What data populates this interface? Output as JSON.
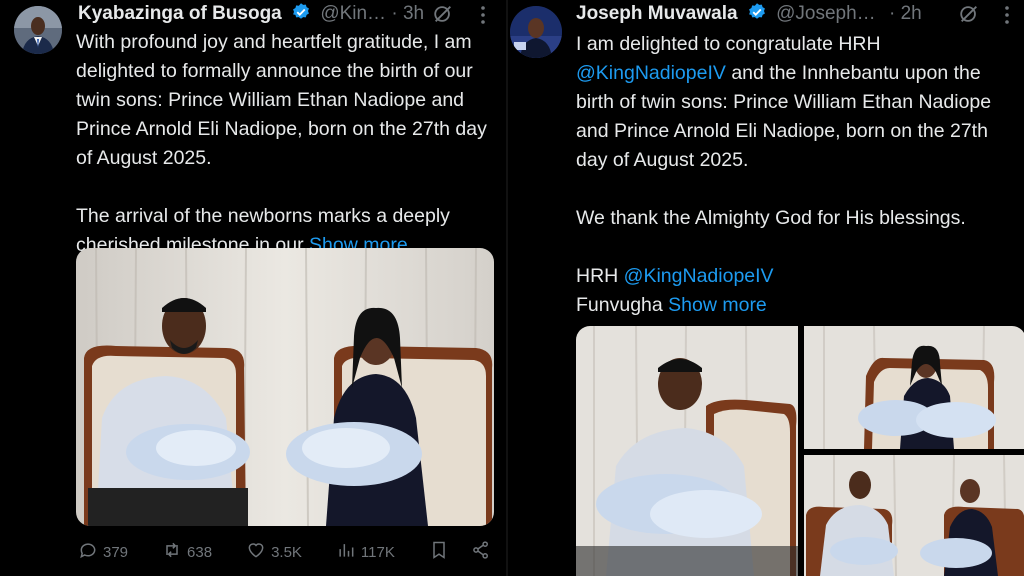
{
  "colors": {
    "background": "#000000",
    "text": "#e7e9ea",
    "secondary": "#71767b",
    "link": "#1d9bf0",
    "verified": "#1d9bf0"
  },
  "tweets": [
    {
      "author": "Kyabazinga of Busoga",
      "handle": "@Kin…",
      "time": "· 3h",
      "verified": true,
      "body_p1": "With profound joy and heartfelt gratitude, I am delighted to formally announce the birth of our twin sons: Prince  William Ethan Nadiope and Prince Arnold Eli Nadiope, born on the 27th day of August 2025.",
      "body_p2": "The arrival of the newborns marks a deeply cherished milestone in our",
      "show_more": "Show more",
      "icons": {
        "grok": "grok-icon",
        "more": "more-icon"
      },
      "actions": {
        "replies": "379",
        "reposts": "638",
        "likes": "3.5K",
        "views": "117K"
      }
    },
    {
      "author": "Joseph Muvawala",
      "handle": "@Joseph…",
      "time": "· 2h",
      "verified": true,
      "body_p1_before": "I am delighted to congratulate HRH",
      "mention1": "@KingNadiopeIV",
      "body_p1_after": "and the Innhebantu upon the birth of twin sons: Prince  William Ethan Nadiope and Prince Arnold Eli Nadiope, born on the 27th day of August 2025.",
      "body_p2": "We thank the Almighty God for His blessings.",
      "body_p3_before": "HRH",
      "mention2": "@KingNadiopeIV",
      "body_p3_line2": "Funvugha",
      "show_more": "Show more",
      "icons": {
        "grok": "grok-icon",
        "more": "more-icon"
      }
    }
  ]
}
